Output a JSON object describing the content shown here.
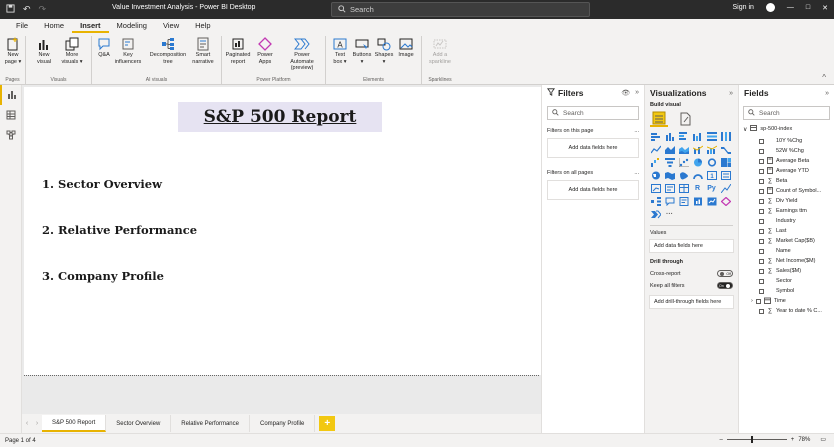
{
  "window": {
    "title": "Value Investment Analysis - Power BI Desktop",
    "search_placeholder": "Search",
    "sign_in": "Sign in",
    "controls": [
      "—",
      "□",
      "✕"
    ]
  },
  "menu_tabs": [
    {
      "label": "File"
    },
    {
      "label": "Home"
    },
    {
      "label": "Insert",
      "active": true
    },
    {
      "label": "Modeling"
    },
    {
      "label": "View"
    },
    {
      "label": "Help"
    }
  ],
  "ribbon": {
    "groups": [
      {
        "label": "Pages",
        "items": [
          {
            "label": "New\npage ▾",
            "icon": "new-page-icon"
          }
        ]
      },
      {
        "label": "Visuals",
        "items": [
          {
            "label": "New\nvisual",
            "icon": "new-visual-icon"
          },
          {
            "label": "More\nvisuals ▾",
            "icon": "more-visuals-icon"
          }
        ]
      },
      {
        "label": "AI visuals",
        "items": [
          {
            "label": "Q&A",
            "icon": "qa-icon"
          },
          {
            "label": "Key\ninfluencers",
            "icon": "key-influencers-icon"
          },
          {
            "label": "Decomposition\ntree",
            "icon": "decomposition-tree-icon"
          },
          {
            "label": "Smart\nnarrative",
            "icon": "smart-narrative-icon"
          }
        ]
      },
      {
        "label": "Power Platform",
        "items": [
          {
            "label": "Paginated\nreport",
            "icon": "paginated-report-icon"
          },
          {
            "label": "Power\nApps",
            "icon": "power-apps-icon"
          },
          {
            "label": "Power Automate\n(preview)",
            "icon": "power-automate-icon"
          }
        ]
      },
      {
        "label": "Elements",
        "items": [
          {
            "label": "Text\nbox ▾",
            "icon": "text-box-icon"
          },
          {
            "label": "Buttons\n▾",
            "icon": "buttons-icon"
          },
          {
            "label": "Shapes\n▾",
            "icon": "shapes-icon"
          },
          {
            "label": "Image",
            "icon": "image-icon"
          }
        ]
      },
      {
        "label": "Sparklines",
        "items": [
          {
            "label": "Add a\nsparkline",
            "icon": "sparkline-icon",
            "disabled": true
          }
        ]
      }
    ]
  },
  "canvas": {
    "report_title": "S&P 500 Report",
    "sections": [
      "1. Sector Overview",
      "2. Relative Performance",
      "3. Company Profile"
    ]
  },
  "page_tabs": [
    {
      "label": "S&P 500 Report",
      "active": true
    },
    {
      "label": "Sector Overview"
    },
    {
      "label": "Relative Performance"
    },
    {
      "label": "Company Profile"
    }
  ],
  "status": {
    "page_indicator": "Page 1 of 4",
    "zoom": "78%"
  },
  "filters_pane": {
    "title": "Filters",
    "search_placeholder": "Search",
    "on_this_page": "Filters on this page",
    "on_all_pages": "Filters on all pages",
    "add_data_fields": "Add data fields here",
    "more": "..."
  },
  "viz_pane": {
    "title": "Visualizations",
    "build_visual": "Build visual",
    "values_label": "Values",
    "values_placeholder": "Add data fields here",
    "drill_through": "Drill through",
    "cross_report": "Cross-report",
    "cross_report_state": "Off",
    "keep_all_filters": "Keep all filters",
    "keep_all_filters_state": "On",
    "drill_placeholder": "Add drill-through fields here",
    "more": "···"
  },
  "fields_pane": {
    "title": "Fields",
    "search_placeholder": "Search",
    "table_name": "sp-500-index",
    "fields": [
      {
        "name": "10Y %Chg",
        "type": "plain"
      },
      {
        "name": "52W %Chg",
        "type": "plain"
      },
      {
        "name": "Average Beta",
        "type": "measure"
      },
      {
        "name": "Average YTD",
        "type": "measure"
      },
      {
        "name": "Beta",
        "type": "sum"
      },
      {
        "name": "Count of Symbol...",
        "type": "measure"
      },
      {
        "name": "Div Yield",
        "type": "sum"
      },
      {
        "name": "Earnings ttm",
        "type": "sum"
      },
      {
        "name": "Industry",
        "type": "plain"
      },
      {
        "name": "Last",
        "type": "sum"
      },
      {
        "name": "Market Cap($B)",
        "type": "sum"
      },
      {
        "name": "Name",
        "type": "plain"
      },
      {
        "name": "Net Income($M)",
        "type": "sum"
      },
      {
        "name": "Sales($M)",
        "type": "sum"
      },
      {
        "name": "Sector",
        "type": "plain"
      },
      {
        "name": "Symbol",
        "type": "plain"
      },
      {
        "name": "Time",
        "type": "date"
      },
      {
        "name": "Year to date % C...",
        "type": "sum"
      }
    ]
  },
  "colors": {
    "accent": "#e8b301",
    "title_bar": "#2b2b2b",
    "title_box": "#e6e3f2",
    "viz_icon": "#2b79d0"
  }
}
